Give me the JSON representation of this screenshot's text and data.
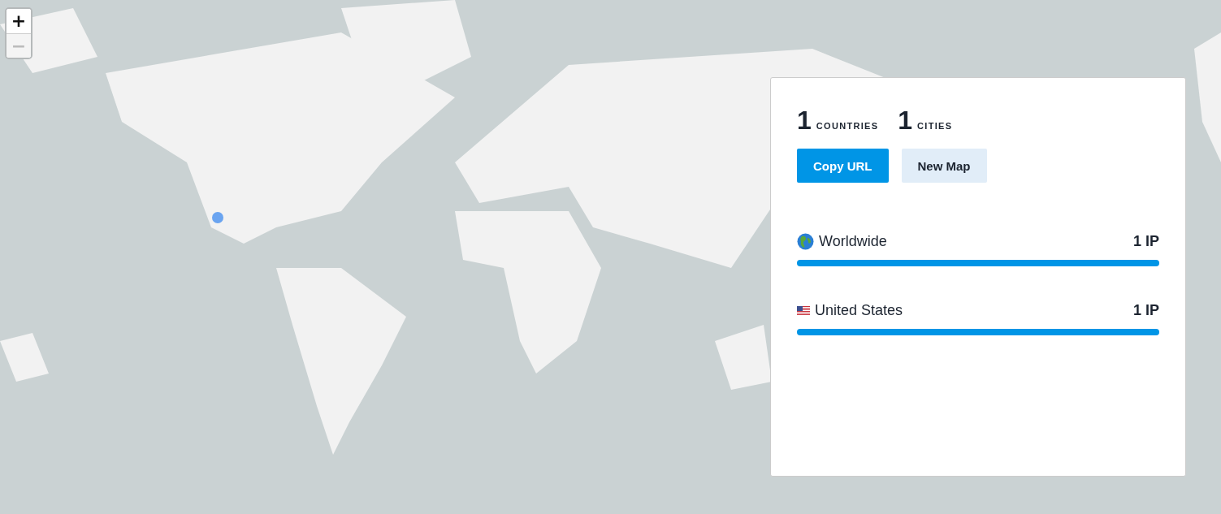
{
  "zoom_controls": [
    {
      "label": "+",
      "disabled": false
    },
    {
      "label": "−",
      "disabled": true
    }
  ],
  "stats": [
    {
      "value": "1",
      "label": "COUNTRIES"
    },
    {
      "value": "1",
      "label": "CITIES"
    }
  ],
  "buttons": [
    {
      "label": "Copy URL",
      "kind": "primary"
    },
    {
      "label": "New Map",
      "kind": "secondary"
    }
  ],
  "breakdown": [
    {
      "kind": "globe",
      "name": "Worldwide",
      "count": "1 IP",
      "level": 1
    },
    {
      "kind": "flag",
      "name": "United States",
      "count": "1 IP",
      "level": 1
    }
  ]
}
